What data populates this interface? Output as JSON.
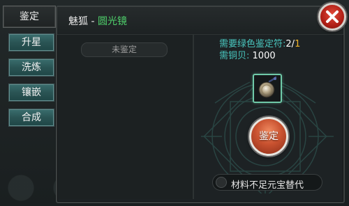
{
  "tabs": {
    "active": "鉴定",
    "items": [
      {
        "label": "升星"
      },
      {
        "label": "洗炼"
      },
      {
        "label": "镶嵌"
      },
      {
        "label": "合成"
      }
    ]
  },
  "header": {
    "owner": "魅狐",
    "separator": "-",
    "item_name": "圆光镜"
  },
  "status": {
    "label": "未鉴定"
  },
  "requirements": {
    "talisman_label": "需要绿色鉴定符:",
    "talisman_have": "2",
    "talisman_sep": "/",
    "talisman_need": "1",
    "copper_label": "需铜贝:",
    "copper_value": "1000"
  },
  "actions": {
    "identify_label": "鉴定",
    "yuanbao_toggle_label": "材料不足元宝替代"
  },
  "colors": {
    "item_name": "#4fd06b",
    "requirement_text": "#49c7bf",
    "highlight_number": "#f0b429",
    "tab_teal": "#2a5454",
    "identify_button": "#c95230"
  }
}
